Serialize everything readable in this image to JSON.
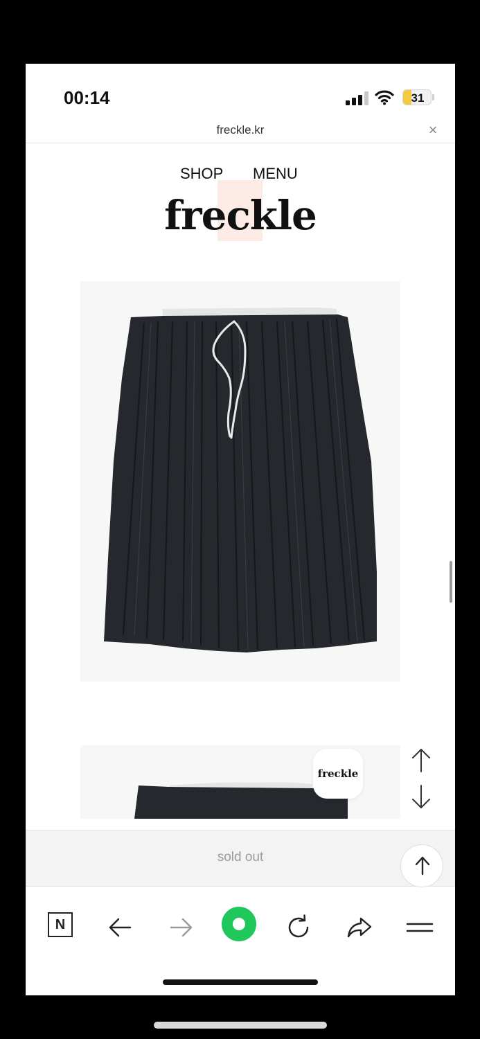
{
  "status_bar": {
    "time": "00:14",
    "battery_level": "31",
    "battery_fraction": 0.31,
    "icons": [
      "signal-icon",
      "wifi-icon",
      "battery-icon"
    ]
  },
  "url_bar": {
    "domain": "freckle.kr",
    "close_glyph": "×"
  },
  "site": {
    "nav": {
      "shop": "SHOP",
      "menu": "MENU"
    },
    "logo": "freckle"
  },
  "product": {
    "image_alt_icon": "pleated-skirt-image",
    "badge": "freckle",
    "status": "sold out"
  },
  "controls": {
    "scroll_up_icon": "arrow-up-icon",
    "scroll_down_icon": "arrow-down-icon",
    "back_to_top_icon": "arrow-up-icon"
  },
  "toolbar": {
    "n_label": "N",
    "items": [
      "naver-icon",
      "back-icon",
      "forward-icon",
      "green-dot-icon",
      "reload-icon",
      "share-icon",
      "menu-icon"
    ]
  },
  "colors": {
    "battery": "#f6c945",
    "green": "#20c75a",
    "skirt": "#25282c",
    "waistband": "#e4e6e6"
  }
}
